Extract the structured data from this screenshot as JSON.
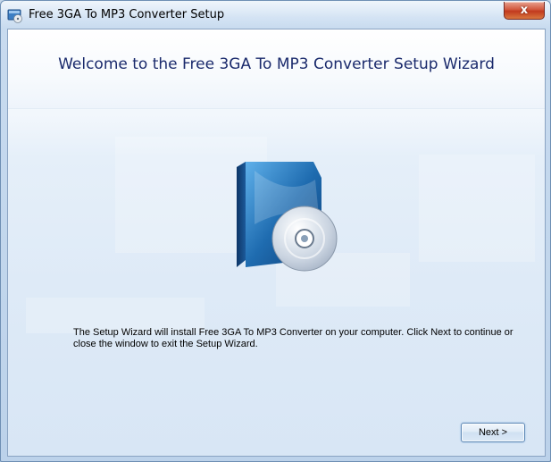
{
  "window": {
    "title": "Free 3GA To MP3 Converter Setup",
    "close_glyph": "x"
  },
  "wizard": {
    "heading": "Welcome to the Free 3GA To MP3 Converter Setup Wizard",
    "description": "The Setup Wizard will install Free 3GA To MP3 Converter on your computer. Click Next to continue or close the window to exit the Setup Wizard.",
    "next_label": "Next >",
    "product_image": "software-box-with-cd-icon"
  },
  "colors": {
    "heading": "#1a2a6c",
    "close_button": "#c23a1e",
    "box_blue": "#1f6cb0"
  }
}
